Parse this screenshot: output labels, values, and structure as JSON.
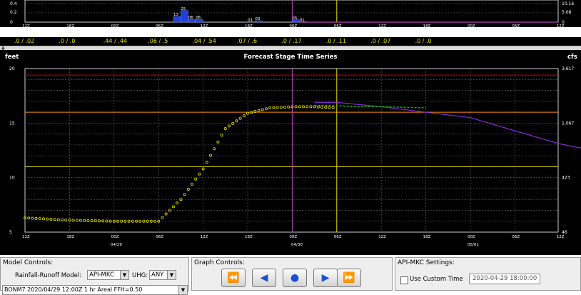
{
  "precip_chart": {
    "y_ticks_left": [
      "0.4",
      "0.2",
      "0"
    ],
    "y_ticks_right": [
      "10.16",
      "5.08",
      "0"
    ],
    "x_ticks": [
      "12Z",
      "18Z",
      "00Z",
      "06Z",
      "12Z",
      "18Z",
      "00Z",
      "06Z",
      "12Z",
      "18Z",
      "00Z",
      "06Z",
      "12Z"
    ],
    "date_labels": [
      "04/29",
      "04/30",
      "05/01"
    ],
    "bar_labels": [
      "13",
      "25",
      "06",
      "06",
      "01",
      "03",
      "05",
      "01"
    ]
  },
  "precip_strip": {
    "values": [
      ".0 / .02",
      ".0 / .0",
      ".44 / .44",
      ".06 / .5",
      ".04 / .54",
      ".07 / .6",
      ".0 / .17",
      ".0 / .11",
      ".0 / .07",
      ".0 / .0"
    ]
  },
  "stage_chart": {
    "title": "Forecast Stage Time Series",
    "ylabel_left": "feet",
    "ylabel_right": "cfs",
    "y_ticks_left": [
      "20",
      "15",
      "10",
      "5"
    ],
    "y_ticks_right": [
      "3,617",
      "1,067",
      "423",
      "46"
    ],
    "x_ticks": [
      "12Z",
      "18Z",
      "00Z",
      "06Z",
      "12Z",
      "18Z",
      "00Z",
      "06Z",
      "12Z",
      "18Z",
      "00Z",
      "06Z",
      "12Z"
    ],
    "date_labels": [
      "04/29",
      "04/30",
      "05/01"
    ],
    "ylim": [
      5,
      20
    ],
    "colors": {
      "observed": "#e8e000",
      "forecast": "#8a2be2",
      "simulated": "#00c000",
      "major_flood": "#cc0000",
      "flood": "#ff8c00",
      "action": "#e8e000",
      "current_time": "#e8e000",
      "forecast_start": "#c040c0"
    }
  },
  "chart_data": [
    {
      "type": "bar",
      "categories": [
        "04/29 12Z",
        "04/29 18Z",
        "04/30 00Z",
        "04/30 06Z",
        "04/30 12Z",
        "04/30 18Z",
        "05/01 00Z",
        "05/01 06Z",
        "05/01 12Z"
      ],
      "values": [
        0.0,
        0.0,
        0.44,
        0.06,
        0.04,
        0.0,
        0.0,
        0.0,
        0.0
      ],
      "ylim": [
        0,
        0.4
      ]
    },
    {
      "type": "line",
      "x_hours": [
        0,
        6,
        12,
        18,
        21,
        24,
        27,
        30,
        33,
        36,
        39,
        42,
        45,
        48,
        54,
        60,
        66,
        72,
        78,
        84,
        90,
        96
      ],
      "series": [
        {
          "values": [
            6.3,
            6.1,
            6.0,
            6.0,
            8.0,
            10.8,
            14.5,
            15.9,
            16.4,
            16.5,
            16.5,
            16.4,
            null,
            null,
            null,
            null,
            null,
            null,
            null,
            null,
            null,
            null
          ]
        },
        {
          "values": [
            null,
            null,
            null,
            null,
            null,
            null,
            null,
            null,
            null,
            null,
            16.9,
            16.9,
            16.7,
            16.5,
            16.0,
            15.5,
            14.3,
            13.1,
            12.3,
            11.6,
            10.1,
            9.3
          ]
        },
        {
          "values": [
            null,
            null,
            null,
            null,
            null,
            null,
            null,
            null,
            null,
            null,
            16.6,
            16.6,
            16.5,
            16.5,
            16.4,
            null,
            null,
            null,
            null,
            null,
            null,
            null
          ]
        }
      ],
      "thresholds": [
        19.4,
        16.0,
        11.0
      ],
      "ylim": [
        5,
        20
      ]
    }
  ],
  "model_controls": {
    "title": "Model Controls:",
    "rr_label": "Rainfall-Runoff Model:",
    "rr_value": "API-MKC",
    "uhg_label": "UHG:",
    "uhg_value": "ANY",
    "ffh_value": "BONM7 2020/04/29 12:00Z 1 hr Areal FFH=0.50"
  },
  "graph_controls": {
    "title": "Graph Controls:",
    "buttons": [
      "first",
      "previous",
      "current",
      "next",
      "last"
    ]
  },
  "api_settings": {
    "title": "API-MKC Settings:",
    "custom_time_label": "Use Custom Time",
    "custom_time_value": "2020-04-29 18:00:00"
  }
}
